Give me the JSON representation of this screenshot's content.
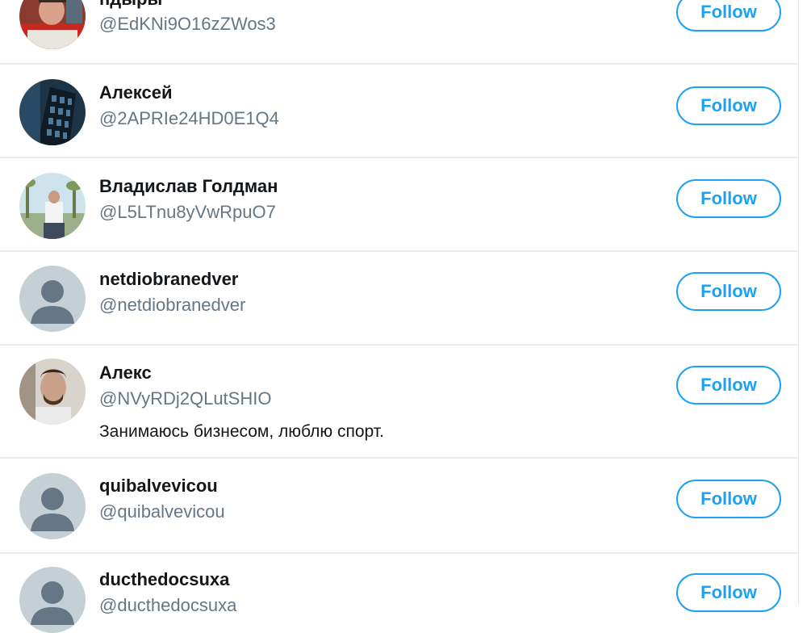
{
  "users": [
    {
      "name": "пдыры",
      "handle": "@EdKNi9O16zZWos3",
      "bio": "",
      "avatar": "photo-avatar-man-red",
      "follow_label": "Follow"
    },
    {
      "name": "Алексей",
      "handle": "@2APRIe24HD0E1Q4",
      "bio": "",
      "avatar": "photo-avatar-building",
      "follow_label": "Follow"
    },
    {
      "name": "Владислав Голдман",
      "handle": "@L5LTnu8yVwRpuO7",
      "bio": "",
      "avatar": "photo-avatar-outdoor",
      "follow_label": "Follow"
    },
    {
      "name": "netdiobranedver",
      "handle": "@netdiobranedver",
      "bio": "",
      "avatar": "default-avatar",
      "follow_label": "Follow"
    },
    {
      "name": "Алекс",
      "handle": "@NVyRDj2QLutSHIO",
      "bio": "Занимаюсь бизнесом, люблю спорт.",
      "avatar": "photo-avatar-man",
      "follow_label": "Follow"
    },
    {
      "name": "quibalvevicou",
      "handle": "@quibalvevicou",
      "bio": "",
      "avatar": "default-avatar",
      "follow_label": "Follow"
    },
    {
      "name": "ducthedocsuxa",
      "handle": "@ducthedocsuxa",
      "bio": "",
      "avatar": "default-avatar",
      "follow_label": "Follow"
    }
  ],
  "colors": {
    "accent": "#1da1f2",
    "name_text": "#14171a",
    "handle_text": "#657786",
    "divider": "#e6ecf0",
    "default_avatar_bg": "#c4cfd6"
  }
}
